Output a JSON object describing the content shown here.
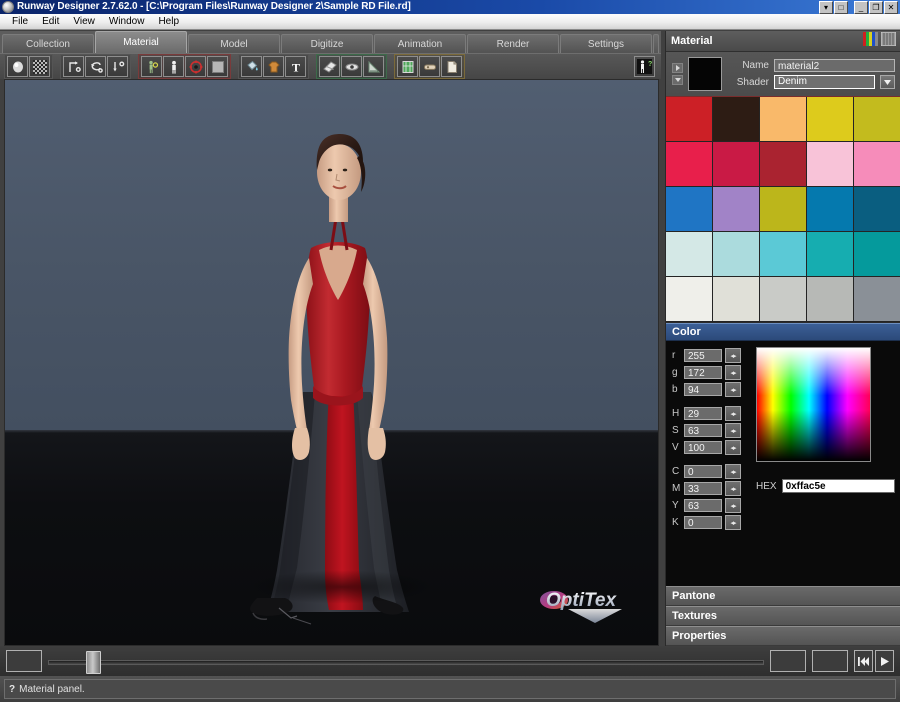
{
  "window": {
    "title": "Runway Designer 2.7.62.0 - [C:\\Program Files\\Runway Designer 2\\Sample RD File.rd]",
    "icon": "app-icon",
    "mdi_controls": [
      {
        "name": "mdi-restore-button",
        "glyph": "▾"
      },
      {
        "name": "mdi-close-button",
        "glyph": "□"
      }
    ],
    "controls": [
      {
        "name": "minimize-button",
        "glyph": "_"
      },
      {
        "name": "maximize-button",
        "glyph": "❐"
      },
      {
        "name": "close-button",
        "glyph": "✕"
      }
    ]
  },
  "menubar": {
    "items": [
      {
        "label": "File"
      },
      {
        "label": "Edit"
      },
      {
        "label": "View"
      },
      {
        "label": "Window"
      },
      {
        "label": "Help"
      }
    ]
  },
  "tabs": {
    "items": [
      {
        "label": "Collection",
        "active": false
      },
      {
        "label": "Material",
        "active": true
      },
      {
        "label": "Model",
        "active": false
      },
      {
        "label": "Digitize",
        "active": false
      },
      {
        "label": "Animation",
        "active": false
      },
      {
        "label": "Render",
        "active": false
      },
      {
        "label": "Settings",
        "active": false
      }
    ]
  },
  "toolbar": {
    "groups": [
      {
        "name": "render-mode-group",
        "buttons": [
          {
            "name": "shaded-sphere-icon"
          },
          {
            "name": "checker-texture-icon"
          }
        ]
      },
      {
        "name": "transform-group",
        "buttons": [
          {
            "name": "move-axis-icon"
          },
          {
            "name": "rotate-axis-icon"
          },
          {
            "name": "scale-axis-icon"
          }
        ]
      },
      {
        "name": "figure-group",
        "buttons": [
          {
            "name": "pose-figure-icon"
          },
          {
            "name": "figure-icon"
          },
          {
            "name": "target-icon"
          },
          {
            "name": "blank-swatch-icon"
          }
        ]
      },
      {
        "name": "material-tools-group",
        "buttons": [
          {
            "name": "paint-bucket-icon"
          },
          {
            "name": "garment-icon"
          },
          {
            "name": "text-tool-icon"
          }
        ]
      },
      {
        "name": "measure-group",
        "buttons": [
          {
            "name": "fabric-fold-icon"
          },
          {
            "name": "eye-view-icon"
          },
          {
            "name": "ruler-triangle-icon"
          }
        ]
      },
      {
        "name": "file-group",
        "buttons": [
          {
            "name": "grid-page-icon"
          },
          {
            "name": "capsule-icon"
          },
          {
            "name": "document-icon"
          }
        ]
      }
    ],
    "right_button": {
      "name": "figure-help-icon"
    }
  },
  "viewport": {
    "name": "3d-viewport",
    "background_color": "#4a5668",
    "floor_color": "#0d0e11",
    "logo_text": "OptiTex",
    "model": {
      "garment_top_color": "#b02028",
      "garment_skirt_color": "#31333a",
      "garment_panel_color": "#b4121c",
      "skin_color": "#e8c4ab",
      "hair_color": "#3a2420"
    }
  },
  "material_panel": {
    "title": "Material",
    "header_icons": [
      {
        "name": "color-bars-icon"
      },
      {
        "name": "swatch-list-icon"
      }
    ],
    "nav": [
      {
        "name": "prev-material-button",
        "glyph": "▸"
      },
      {
        "name": "next-material-button",
        "glyph": "▾"
      }
    ],
    "preview_color": "#050505",
    "name_label": "Name",
    "name_value": "material2",
    "shader_label": "Shader",
    "shader_value": "Denim",
    "shader_options": [
      "Denim"
    ],
    "swatches": [
      "#cc2026",
      "#2d1c14",
      "#f9b96a",
      "#ddcb1c",
      "#c3bb1e",
      "#e81f4b",
      "#c91a45",
      "#aa2330",
      "#f8c3d8",
      "#f68cba",
      "#1f75c4",
      "#a183c7",
      "#bcb61b",
      "#0579ae",
      "#0a5e80",
      "#d4e8e6",
      "#abdbdd",
      "#5bc9d6",
      "#16adb0",
      "#059a9c",
      "#efefea",
      "#e0e0d8",
      "#c9cbc7",
      "#b7b9b6",
      "#8a9097"
    ]
  },
  "color_section": {
    "title": "Color",
    "rgb": [
      {
        "label": "r",
        "value": "255"
      },
      {
        "label": "g",
        "value": "172"
      },
      {
        "label": "b",
        "value": "94"
      }
    ],
    "hsv": [
      {
        "label": "H",
        "value": "29"
      },
      {
        "label": "S",
        "value": "63"
      },
      {
        "label": "V",
        "value": "100"
      }
    ],
    "cmyk": [
      {
        "label": "C",
        "value": "0"
      },
      {
        "label": "M",
        "value": "33"
      },
      {
        "label": "Y",
        "value": "63"
      },
      {
        "label": "K",
        "value": "0"
      }
    ],
    "hex_label": "HEX",
    "hex_value": "0xffac5e",
    "spinner_glyph": "◂▸"
  },
  "collapsed_sections": [
    {
      "name": "pantone-section",
      "label": "Pantone"
    },
    {
      "name": "textures-section",
      "label": "Textures"
    },
    {
      "name": "properties-section",
      "label": "Properties"
    }
  ],
  "timeline": {
    "left_box_value": "",
    "frame_box_value": "",
    "end_box_value": "",
    "buttons": [
      {
        "name": "rewind-button",
        "glyph": "⏮"
      },
      {
        "name": "play-button",
        "glyph": "▶"
      }
    ]
  },
  "statusbar": {
    "help_glyph": "?",
    "message": "Material panel."
  }
}
